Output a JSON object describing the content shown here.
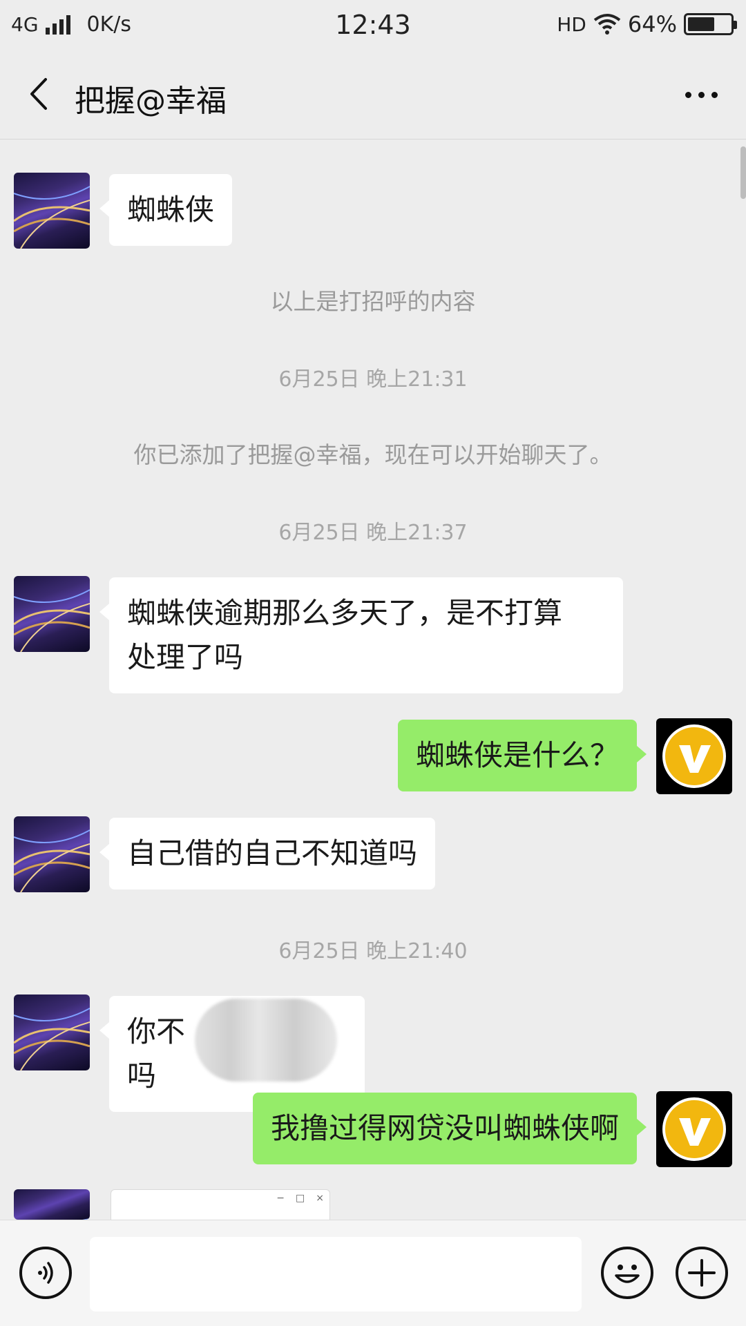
{
  "status_bar": {
    "network": "4G",
    "speed": "0K/s",
    "time": "12:43",
    "hd": "HD",
    "battery_text": "64%",
    "battery_level": 0.64
  },
  "header": {
    "title": "把握@幸福",
    "back_icon": "chevron-left-icon",
    "more_icon": "more-dots-icon"
  },
  "chat": {
    "msg1": "蜘蛛侠",
    "sys_greeting": "以上是打招呼的内容",
    "ts1": "6月25日 晚上21:31",
    "sys_added": "你已添加了把握@幸福，现在可以开始聊天了。",
    "ts2": "6月25日 晚上21:37",
    "msg2_line1": "蜘蛛侠逾期那么多天了，是不打算",
    "msg2_line2": "处理了吗",
    "msg3": "蜘蛛侠是什么？",
    "msg4": "自己借的自己不知道吗",
    "ts3": "6月25日 晚上21:40",
    "msg5_start": "你不",
    "msg5_end": "吗",
    "msg6": "我撸过得网贷没叫蜘蛛侠啊",
    "window_ctrls": [
      "−",
      "□",
      "×"
    ]
  },
  "input_bar": {
    "voice_icon": "voice-icon",
    "emoji_icon": "emoji-icon",
    "plus_icon": "plus-icon"
  },
  "colors": {
    "background": "#ededed",
    "outgoing_bubble": "#95ec69",
    "incoming_bubble": "#ffffff",
    "system_text": "#9a9a9a"
  }
}
